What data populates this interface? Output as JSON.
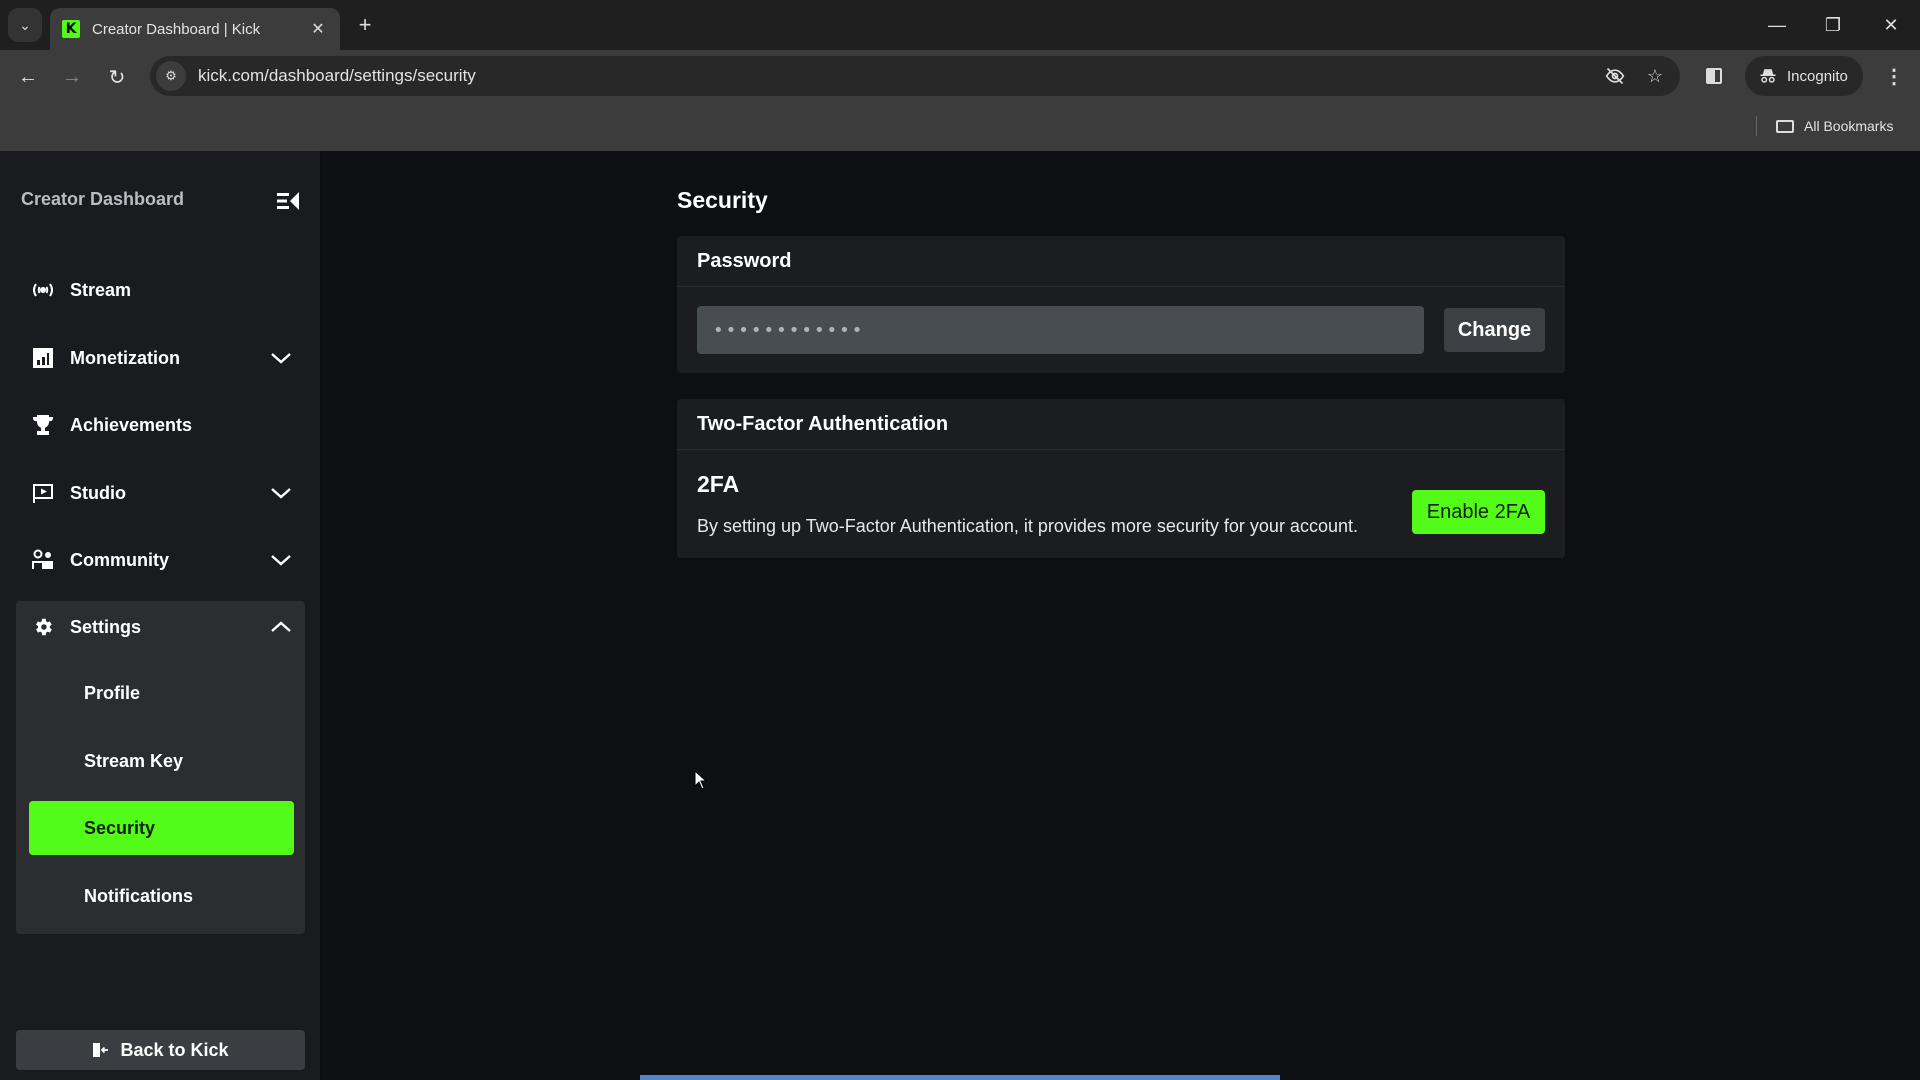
{
  "browser": {
    "tab": {
      "title": "Creator Dashboard | Kick",
      "favicon_letter": "K"
    },
    "new_tab_label": "+",
    "url": "kick.com/dashboard/settings/security",
    "profile_label": "Incognito",
    "bookmarks_label": "All Bookmarks",
    "window_controls": {
      "minimize": "—",
      "restore": "❐",
      "close": "✕"
    },
    "icons": {
      "back": "←",
      "forward": "→",
      "reload": "↻",
      "site_info": "⚙",
      "eye_off": "◎",
      "star": "☆",
      "menu": "⋮",
      "tab_list": "⌄",
      "tab_close": "✕"
    }
  },
  "sidebar": {
    "title": "Creator Dashboard",
    "items": [
      {
        "label": "Stream",
        "icon": "broadcast-icon",
        "expandable": false
      },
      {
        "label": "Monetization",
        "icon": "chart-icon",
        "expandable": true,
        "expanded": false
      },
      {
        "label": "Achievements",
        "icon": "trophy-icon",
        "expandable": false
      },
      {
        "label": "Studio",
        "icon": "studio-icon",
        "expandable": true,
        "expanded": false
      },
      {
        "label": "Community",
        "icon": "community-icon",
        "expandable": true,
        "expanded": false
      },
      {
        "label": "Settings",
        "icon": "gear-icon",
        "expandable": true,
        "expanded": true
      }
    ],
    "settings_sub_items": [
      {
        "label": "Profile",
        "active": false
      },
      {
        "label": "Stream Key",
        "active": false
      },
      {
        "label": "Security",
        "active": true
      },
      {
        "label": "Notifications",
        "active": false
      }
    ],
    "back_label": "Back to Kick"
  },
  "main": {
    "title": "Security",
    "password": {
      "heading": "Password",
      "value": "••••••••••••",
      "change_label": "Change"
    },
    "two_factor": {
      "heading": "Two-Factor Authentication",
      "label": "2FA",
      "description": "By setting up Two-Factor Authentication, it provides more security for your account.",
      "enable_label": "Enable 2FA"
    }
  },
  "colors": {
    "accent": "#53fc18",
    "sidebar_bg": "#191b1e",
    "card_bg": "#1b1d20",
    "page_bg": "#0e0f12",
    "loading_bar": "#4f86c6"
  }
}
